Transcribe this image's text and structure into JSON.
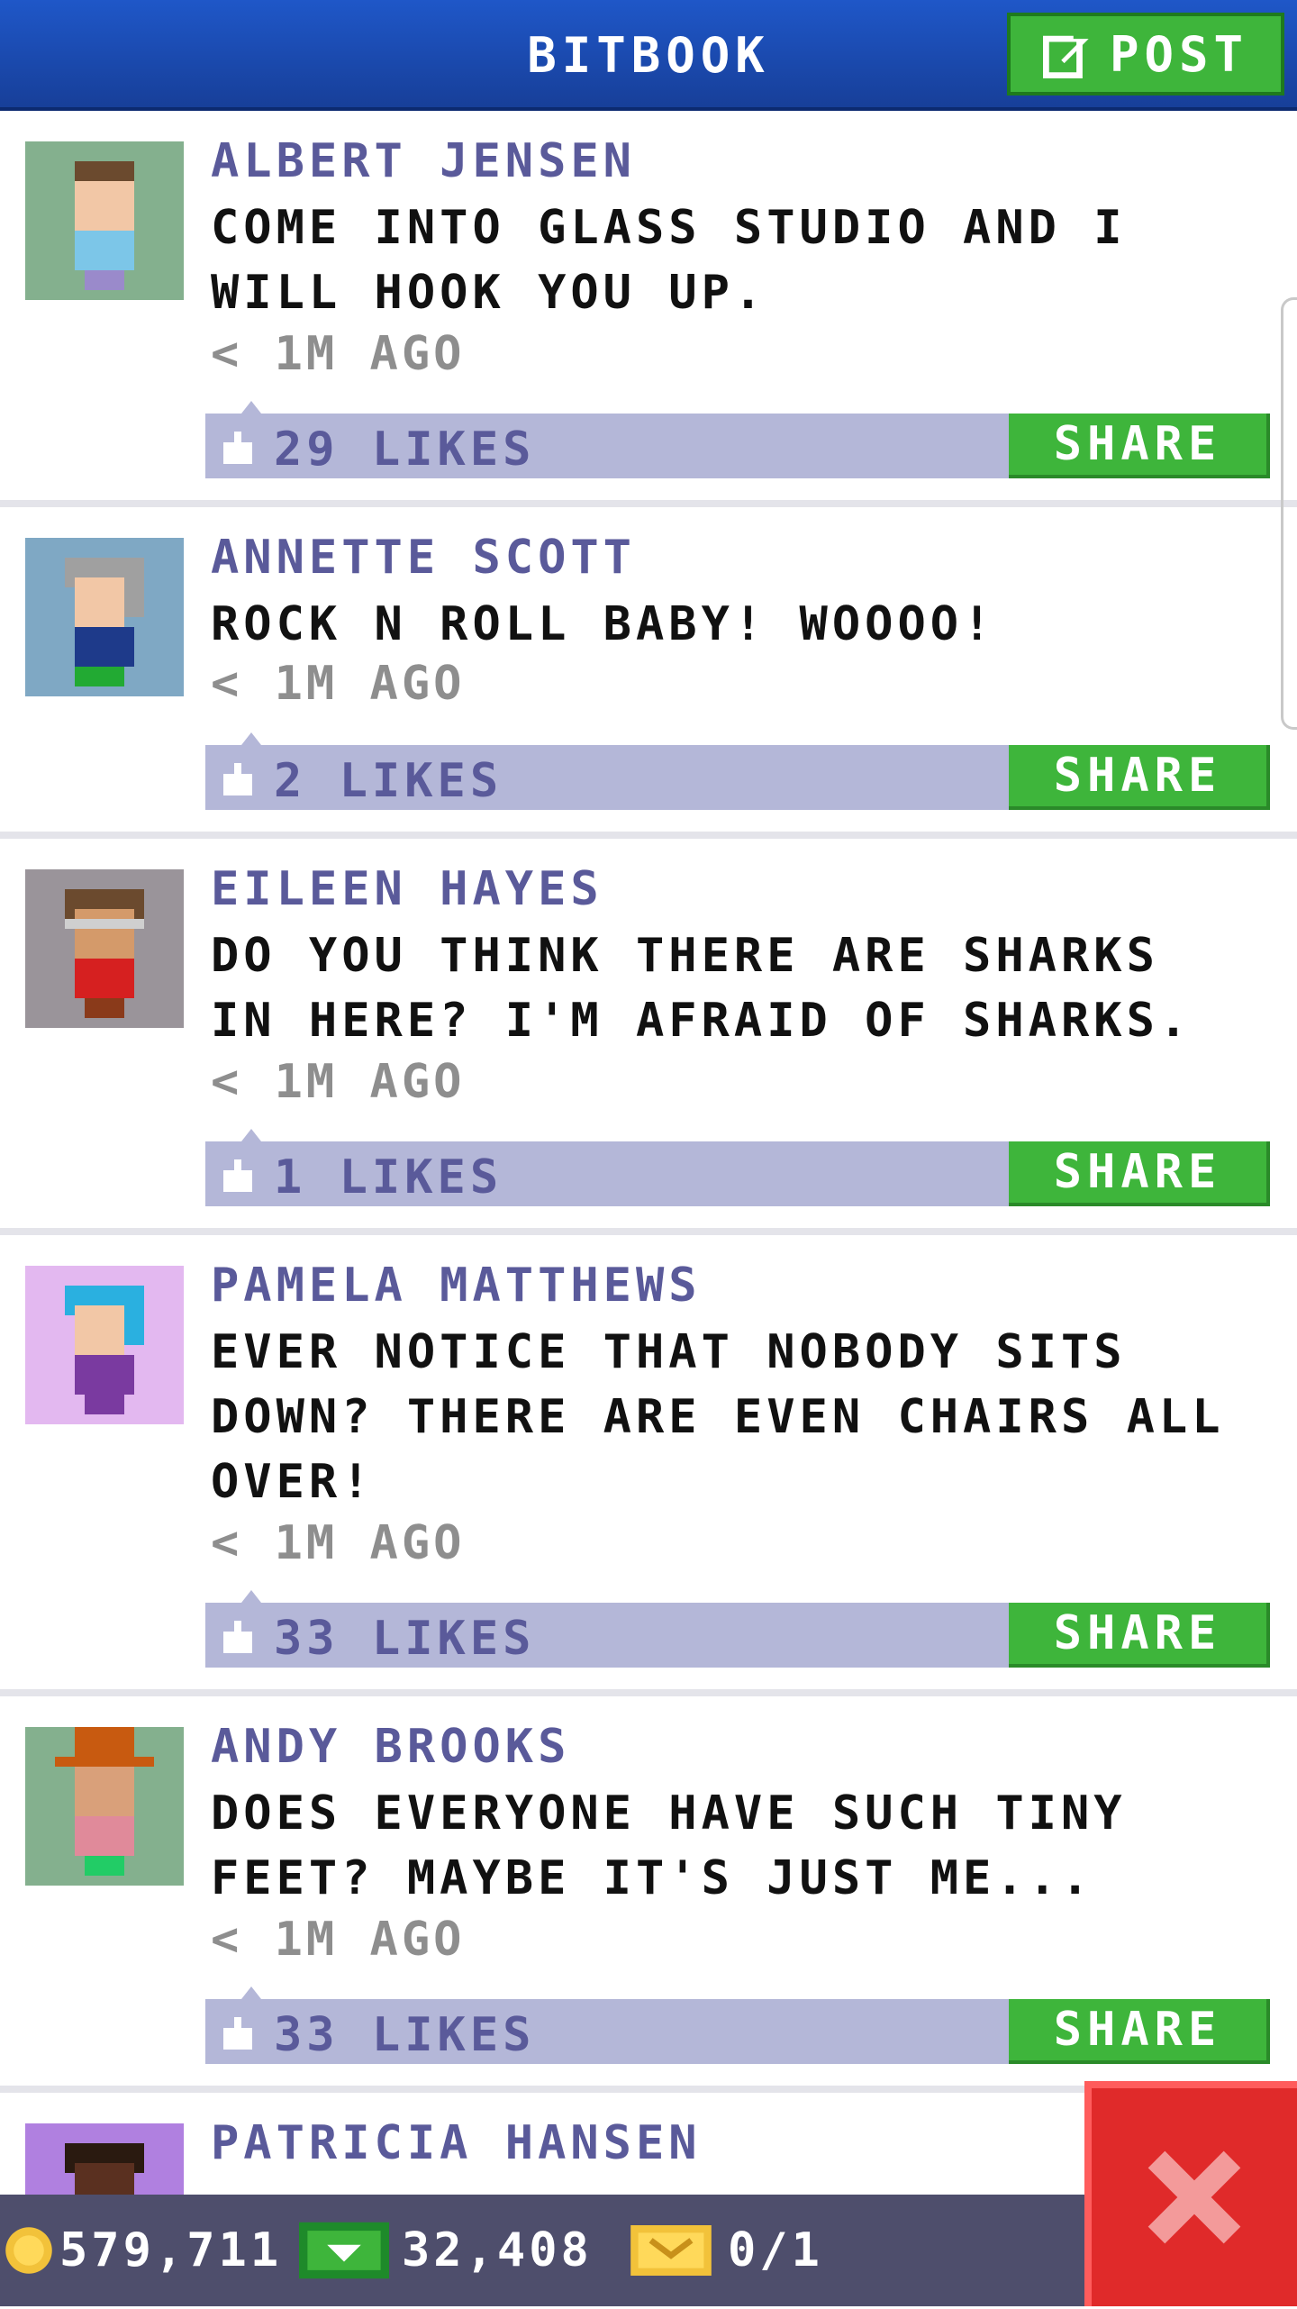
{
  "header": {
    "title": "BITBOOK",
    "post_label": "POST"
  },
  "posts": [
    {
      "author": "ALBERT JENSEN",
      "message": "COME INTO GLASS STUDIO AND I WILL HOOK YOU UP.",
      "time": "< 1M AGO",
      "likes": "29 LIKES",
      "share_label": "SHARE",
      "avatar_bg": "#84b08e",
      "skin": "#f2c7a6",
      "hair": "#6b4a2e",
      "shirt": "#7cc6e8",
      "pants": "#9a8acb"
    },
    {
      "author": "ANNETTE SCOTT",
      "message": "ROCK N ROLL BABY! WOOOO!",
      "time": "< 1M AGO",
      "likes": "2 LIKES",
      "share_label": "SHARE",
      "avatar_bg": "#7fa8c4",
      "skin": "#f2c7a6",
      "hair": "#a0a0a0",
      "shirt": "#1e3a8a",
      "pants": "#22aa33"
    },
    {
      "author": "EILEEN HAYES",
      "message": "DO YOU THINK THERE ARE SHARKS IN HERE? I'M AFRAID OF SHARKS.",
      "time": "< 1M AGO",
      "likes": "1 LIKES",
      "share_label": "SHARE",
      "avatar_bg": "#9a949a",
      "skin": "#d49a6a",
      "hair": "#6b4a2e",
      "shirt": "#d62020",
      "pants": "#8a3a1a"
    },
    {
      "author": "PAMELA MATTHEWS",
      "message": "EVER NOTICE THAT NOBODY SITS DOWN? THERE ARE EVEN CHAIRS ALL OVER!",
      "time": "< 1M AGO",
      "likes": "33 LIKES",
      "share_label": "SHARE",
      "avatar_bg": "#e3b8f0",
      "skin": "#f2c7a6",
      "hair": "#2ab0e0",
      "shirt": "#7a3aa0",
      "pants": "#7a3aa0"
    },
    {
      "author": "ANDY BROOKS",
      "message": "DOES EVERYONE HAVE SUCH TINY FEET? MAYBE IT'S JUST ME...",
      "time": "< 1M AGO",
      "likes": "33 LIKES",
      "share_label": "SHARE",
      "avatar_bg": "#84b08e",
      "skin": "#d9a07a",
      "hair": "#c85a10",
      "shirt": "#e08a9a",
      "pants": "#22cc66"
    },
    {
      "author": "PATRICIA HANSEN",
      "message": "",
      "time": "",
      "likes": "",
      "share_label": "",
      "avatar_bg": "#b080e0",
      "skin": "#5a3020",
      "hair": "#2a1a10",
      "shirt": "#7a3aa0",
      "pants": "#7a3aa0"
    }
  ],
  "footer": {
    "coins": "579,711",
    "bux": "32,408",
    "tickets": "0/1"
  },
  "colors": {
    "accent_green": "#3eb53b",
    "header_blue": "#1f57c8",
    "like_bar": "#b4b7d8",
    "close_red": "#e02a2a"
  },
  "icons": {
    "post": "edit-icon",
    "like": "thumb-up-icon",
    "coin": "coin-icon",
    "bux": "bux-icon",
    "ticket": "ticket-icon",
    "close": "close-icon"
  }
}
